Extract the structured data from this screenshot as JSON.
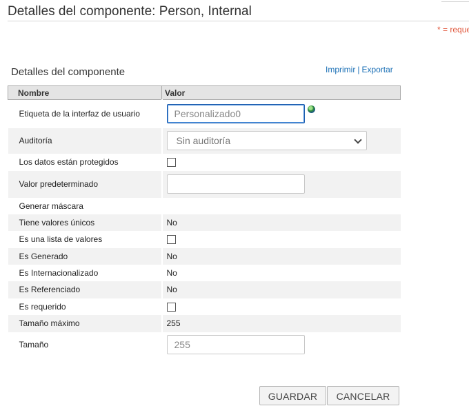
{
  "page": {
    "title": "Detalles del componente: Person, Internal",
    "required_note": "* = reque"
  },
  "section": {
    "title": "Detalles del componente",
    "links": {
      "print": "Imprimir",
      "separator": "|",
      "export": "Exportar"
    }
  },
  "table": {
    "headers": {
      "name": "Nombre",
      "value": "Valor"
    },
    "rows": [
      {
        "label": "Etiqueta de la interfaz de usuario",
        "type": "text",
        "value": "Personalizado0",
        "focused": true,
        "globe_icon": "globe-icon"
      },
      {
        "label": "Auditoría",
        "type": "select",
        "value": "Sin auditoría"
      },
      {
        "label": "Los datos están protegidos",
        "type": "checkbox",
        "checked": false
      },
      {
        "label": "Valor predeterminado",
        "type": "text",
        "value": ""
      },
      {
        "label": "Generar máscara",
        "type": "empty"
      },
      {
        "label": "Tiene valores únicos",
        "type": "static",
        "value": "No"
      },
      {
        "label": "Es una lista de valores",
        "type": "checkbox",
        "checked": false
      },
      {
        "label": "Es Generado",
        "type": "static",
        "value": "No"
      },
      {
        "label": "Es Internacionalizado",
        "type": "static",
        "value": "No"
      },
      {
        "label": "Es Referenciado",
        "type": "static",
        "value": "No"
      },
      {
        "label": "Es requerido",
        "type": "checkbox",
        "checked": false
      },
      {
        "label": "Tamaño máximo",
        "type": "static",
        "value": "255"
      },
      {
        "label": "Tamaño",
        "type": "text",
        "value": "255"
      }
    ]
  },
  "buttons": {
    "save": "GUARDAR",
    "cancel": "CANCELAR"
  },
  "colors": {
    "link": "#1a6fb5",
    "required": "#e0553a",
    "focus_border": "#1f5fb0",
    "row_alt": "#f2f2f2"
  }
}
